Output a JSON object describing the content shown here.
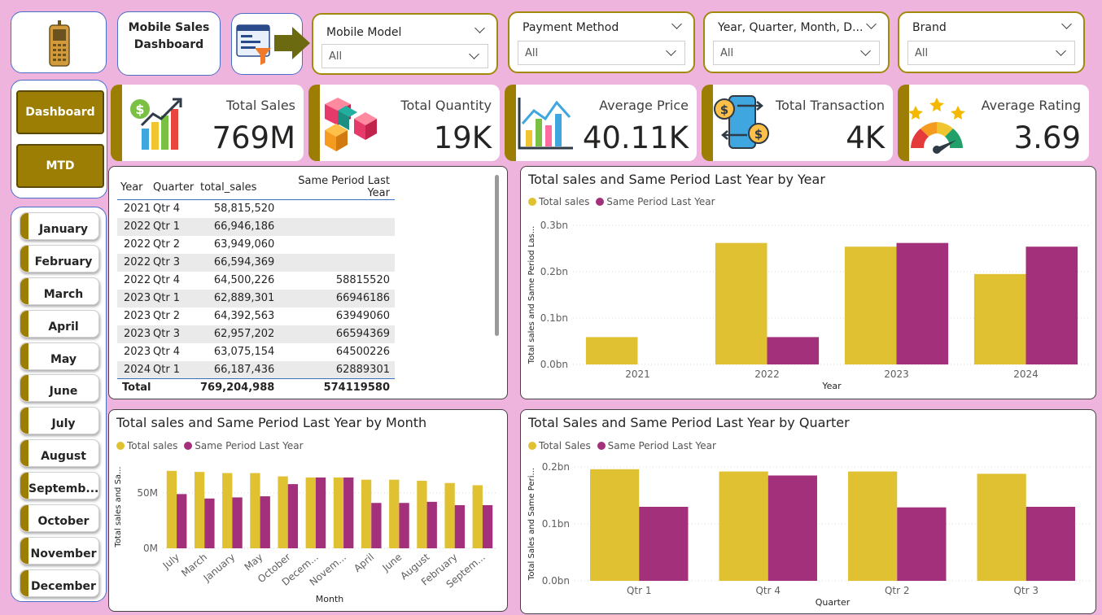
{
  "header": {
    "title_line1": "Mobile Sales",
    "title_line2": "Dashboard"
  },
  "icons": {
    "phone": "mobile-phone-icon",
    "filter": "filter-panel-icon",
    "sales": "sales-chart-icon",
    "quantity": "boxes-icon",
    "price": "price-chart-icon",
    "transaction": "transaction-icon",
    "rating": "rating-gauge-icon"
  },
  "slicers": [
    {
      "title": "Mobile Model",
      "value": "All"
    },
    {
      "title": "Payment Method",
      "value": "All"
    },
    {
      "title": "Year, Quarter, Month, D...",
      "value": "All"
    },
    {
      "title": "Brand",
      "value": "All"
    }
  ],
  "nav": {
    "dashboard": "Dashboard",
    "mtd": "MTD"
  },
  "months": [
    "January",
    "February",
    "March",
    "April",
    "May",
    "June",
    "July",
    "August",
    "Septemb...",
    "October",
    "November",
    "December"
  ],
  "kpis": [
    {
      "label": "Total Sales",
      "value": "769M"
    },
    {
      "label": "Total Quantity",
      "value": "19K"
    },
    {
      "label": "Average Price",
      "value": "40.11K"
    },
    {
      "label": "Total Transaction",
      "value": "4K"
    },
    {
      "label": "Average Rating",
      "value": "3.69"
    }
  ],
  "table": {
    "headers": [
      "Year",
      "Quarter",
      "total_sales",
      "Same Period Last Year"
    ],
    "rows": [
      [
        "2021",
        "Qtr 4",
        "58,815,520",
        ""
      ],
      [
        "2022",
        "Qtr 1",
        "66,946,186",
        ""
      ],
      [
        "2022",
        "Qtr 2",
        "63,949,060",
        ""
      ],
      [
        "2022",
        "Qtr 3",
        "66,594,369",
        ""
      ],
      [
        "2022",
        "Qtr 4",
        "64,500,226",
        "58815520"
      ],
      [
        "2023",
        "Qtr 1",
        "62,889,301",
        "66946186"
      ],
      [
        "2023",
        "Qtr 2",
        "64,392,563",
        "63949060"
      ],
      [
        "2023",
        "Qtr 3",
        "62,957,202",
        "66594369"
      ],
      [
        "2023",
        "Qtr 4",
        "63,075,154",
        "64500226"
      ],
      [
        "2024",
        "Qtr 1",
        "66,187,436",
        "62889301"
      ]
    ],
    "total": [
      "Total",
      "",
      "769,204,988",
      "574119580"
    ]
  },
  "colors": {
    "gold": "#e0c132",
    "purple": "#a3307a",
    "olive": "#9c7e05"
  },
  "chart_data": [
    {
      "type": "bar",
      "title": "Total sales and Same Period Last Year by Year",
      "xlabel": "Year",
      "ylabel": "Total sales and Same Period Las...",
      "legend": [
        "Total sales",
        "Same Period Last Year"
      ],
      "categories": [
        "2021",
        "2022",
        "2023",
        "2024"
      ],
      "yticks": [
        "0.0bn",
        "0.1bn",
        "0.2bn",
        "0.3bn"
      ],
      "ylim": [
        0,
        0.3
      ],
      "series": [
        {
          "name": "Total sales",
          "values": [
            0.059,
            0.262,
            0.254,
            0.195
          ]
        },
        {
          "name": "Same Period Last Year",
          "values": [
            0,
            0.059,
            0.262,
            0.254
          ]
        }
      ]
    },
    {
      "type": "bar",
      "title": "Total sales and Same Period Last Year by Month",
      "xlabel": "Month",
      "ylabel": "Total sales and Sa...",
      "legend": [
        "Total sales",
        "Same Period Last Year"
      ],
      "categories": [
        "July",
        "March",
        "January",
        "May",
        "October",
        "Decem...",
        "Novem...",
        "April",
        "June",
        "August",
        "February",
        "Septem..."
      ],
      "yticks": [
        "0M",
        "50M"
      ],
      "ylim": [
        0,
        75
      ],
      "series": [
        {
          "name": "Total sales",
          "values": [
            70,
            69,
            68,
            68,
            65,
            64,
            64,
            62,
            62,
            61,
            59,
            57
          ]
        },
        {
          "name": "Same Period Last Year",
          "values": [
            49,
            45,
            46,
            47,
            58,
            64,
            64,
            41,
            41,
            42,
            39,
            39
          ]
        }
      ]
    },
    {
      "type": "bar",
      "title": "Total Sales and Same Period Last Year by Quarter",
      "xlabel": "Quarter",
      "ylabel": "Total Sales and Same Peri...",
      "legend": [
        "Total Sales",
        "Same Period Last Year"
      ],
      "categories": [
        "Qtr 1",
        "Qtr 4",
        "Qtr 2",
        "Qtr 3"
      ],
      "yticks": [
        "0.0bn",
        "0.1bn",
        "0.2bn"
      ],
      "ylim": [
        0,
        0.2
      ],
      "series": [
        {
          "name": "Total Sales",
          "values": [
            0.196,
            0.192,
            0.192,
            0.188
          ]
        },
        {
          "name": "Same Period Last Year",
          "values": [
            0.13,
            0.185,
            0.129,
            0.13
          ]
        }
      ]
    }
  ]
}
